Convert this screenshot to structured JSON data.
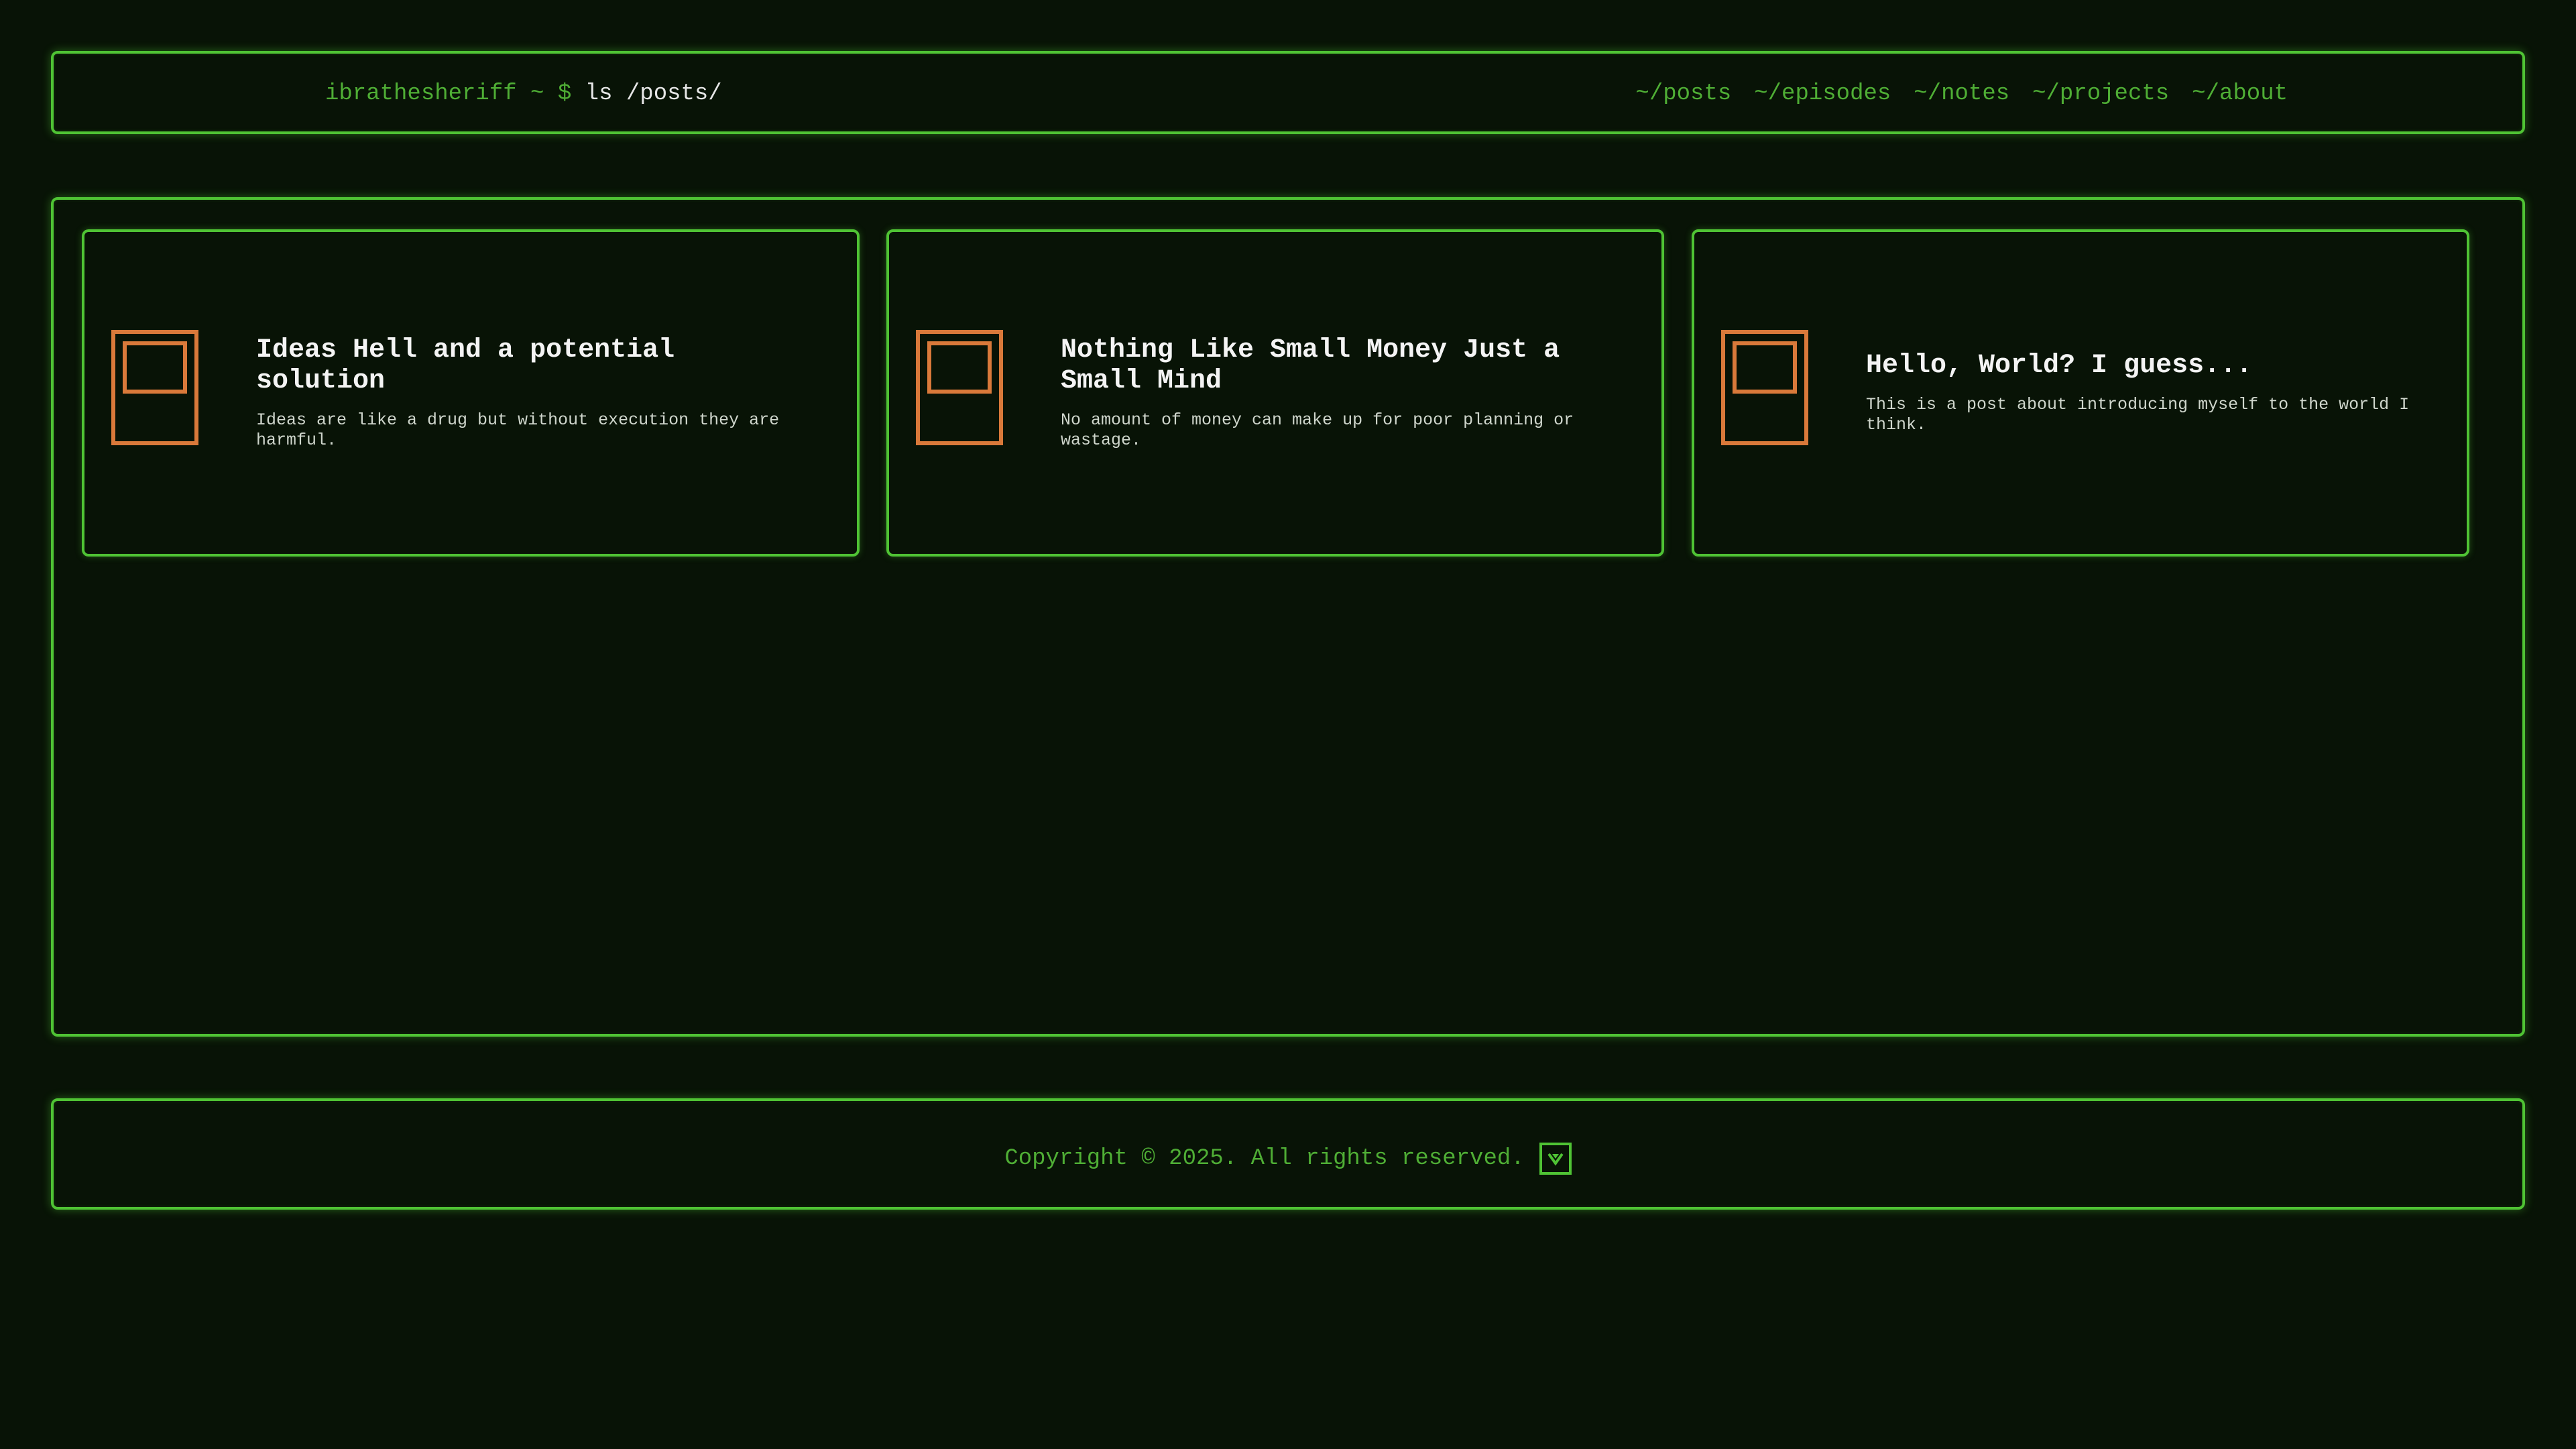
{
  "header": {
    "prompt_host": "ibrathesheriff ~ $",
    "prompt_command": "ls /posts/",
    "nav": [
      {
        "label": "~/posts"
      },
      {
        "label": "~/episodes"
      },
      {
        "label": "~/notes"
      },
      {
        "label": "~/projects"
      },
      {
        "label": "~/about"
      }
    ]
  },
  "posts": [
    {
      "title": "Ideas Hell and a potential solution",
      "description": "Ideas are like a drug but without execution they are harmful.",
      "icon": "document-icon"
    },
    {
      "title": "Nothing Like Small Money Just a Small Mind",
      "description": "No amount of money can make up for poor planning or wastage.",
      "icon": "document-icon"
    },
    {
      "title": "Hello, World? I guess...",
      "description": "This is a post about introducing myself to the world I think.",
      "icon": "document-icon"
    }
  ],
  "footer": {
    "copyright": "Copyright © 2025. All rights reserved.",
    "toggle_icon": "chevron-down-icon"
  },
  "colors": {
    "background": "#081306",
    "accent": "#4fc334",
    "icon": "#d9793a"
  }
}
